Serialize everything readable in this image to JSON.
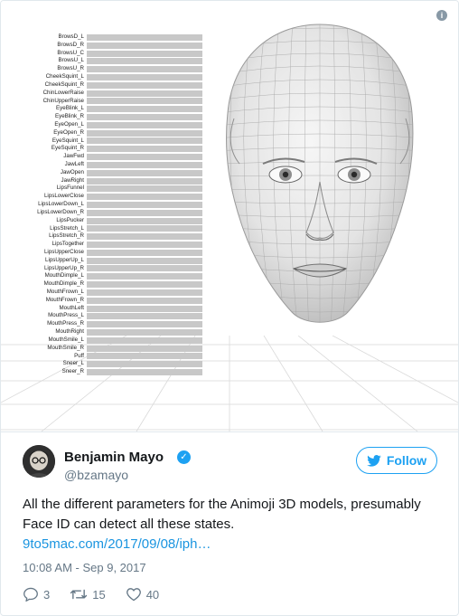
{
  "media": {
    "parameters": [
      "BrowsD_L",
      "BrowsD_R",
      "BrowsU_C",
      "BrowsU_L",
      "BrowsU_R",
      "CheekSquint_L",
      "CheekSquint_R",
      "ChinLowerRaise",
      "ChinUpperRaise",
      "EyeBlink_L",
      "EyeBlink_R",
      "EyeOpen_L",
      "EyeOpen_R",
      "EyeSquint_L",
      "EyeSquint_R",
      "JawFwd",
      "JawLeft",
      "JawOpen",
      "JawRight",
      "LipsFunnel",
      "LipsLowerClose",
      "LipsLowerDown_L",
      "LipsLowerDown_R",
      "LipsPucker",
      "LipsStretch_L",
      "LipsStretch_R",
      "LipsTogether",
      "LipsUpperClose",
      "LipsUpperUp_L",
      "LipsUpperUp_R",
      "MouthDimple_L",
      "MouthDimple_R",
      "MouthFrown_L",
      "MouthFrown_R",
      "MouthLeft",
      "MouthPress_L",
      "MouthPress_R",
      "MouthRight",
      "MouthSmile_L",
      "MouthSmile_R",
      "Puff",
      "Sneer_L",
      "Sneer_R"
    ]
  },
  "tweet": {
    "author_name": "Benjamin Mayo",
    "author_handle": "@bzamayo",
    "follow_label": "Follow",
    "text": "All the different parameters for the Animoji 3D models, presumably Face ID can detect all these states.",
    "link_text": "9to5mac.com/2017/09/08/iph…",
    "timestamp": "10:08 AM - Sep 9, 2017",
    "reply_count": "3",
    "retweet_count": "15",
    "like_count": "40"
  },
  "icons": {
    "info": "info-icon",
    "verified": "verified-badge-icon",
    "follow": "bird-icon",
    "reply": "reply-icon",
    "retweet": "retweet-icon",
    "like": "heart-icon"
  },
  "colors": {
    "accent": "#1da1f2",
    "link": "#1b95e0",
    "muted": "#657786",
    "bar": "#c8c8c8"
  }
}
